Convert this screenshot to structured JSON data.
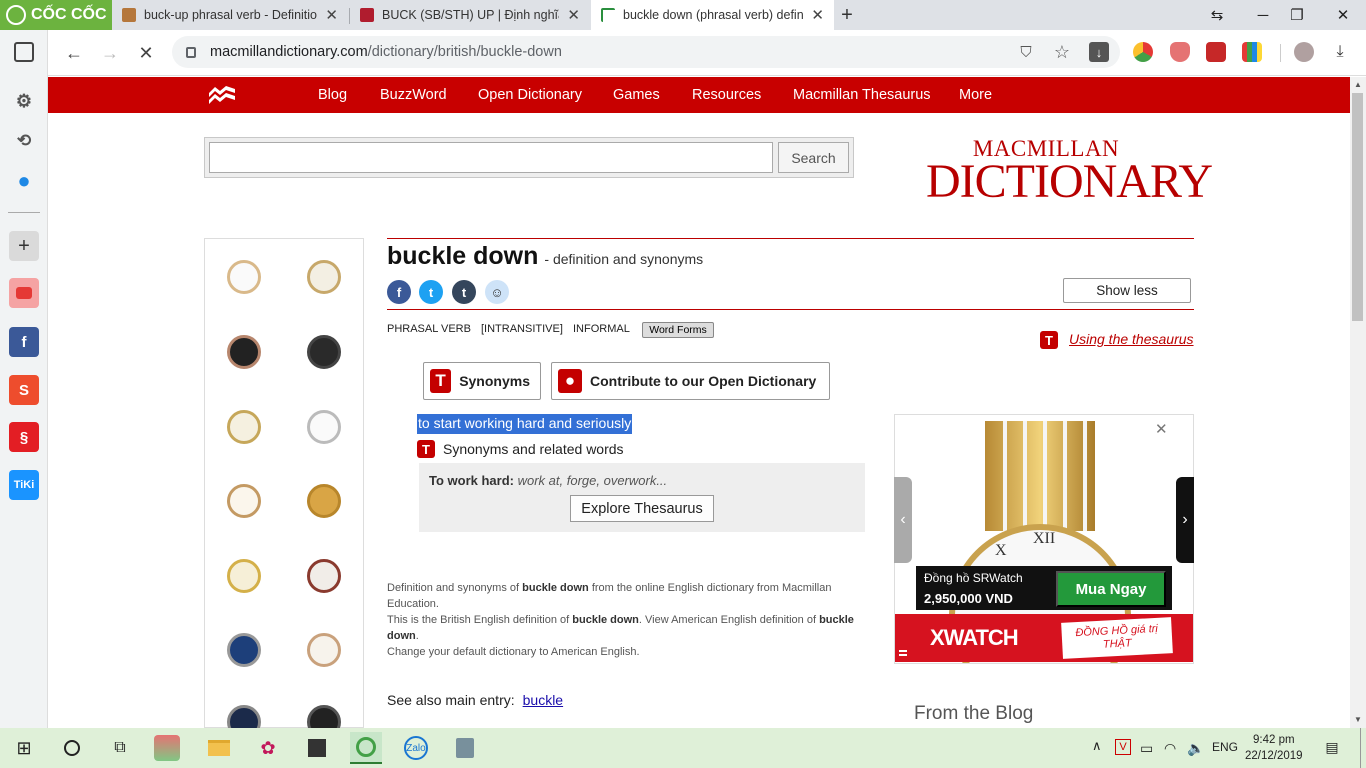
{
  "browser": {
    "brand": "CỐC CỐC",
    "tabs": [
      {
        "title": "buck-up phrasal verb - Definition, p",
        "close": "✕"
      },
      {
        "title": "BUCK (SB/STH) UP | Định nghĩa trong",
        "close": "✕"
      },
      {
        "title": "buckle down (phrasal verb) definitio",
        "close": "✕"
      }
    ],
    "new_tab": "+",
    "window_controls": {
      "minimize": "─",
      "restore": "❐",
      "close": "✕"
    },
    "url_domain": "macmillandictionary.com",
    "url_path": "/dictionary/british/buckle-down",
    "icons": [
      "back-icon",
      "forward-icon",
      "stop-icon",
      "shield-icon",
      "star-icon",
      "download-icon",
      "profile-icon"
    ]
  },
  "sidebar": {
    "items": [
      "settings-icon",
      "history-icon",
      "messenger-icon",
      "add-icon",
      "youtube-icon",
      "facebook-icon",
      "shopee-icon",
      "sendo-icon",
      "tiki-icon"
    ],
    "tiki": "TiKi",
    "shopee": "S",
    "facebook": "f",
    "add": "+"
  },
  "site_nav": [
    "Blog",
    "BuzzWord",
    "Open Dictionary",
    "Games",
    "Resources",
    "Macmillan Thesaurus",
    "More"
  ],
  "search": {
    "button": "Search",
    "value": ""
  },
  "logo": {
    "line1": "MACMILLAN",
    "line2": "DICTIONARY"
  },
  "entry": {
    "headword": "buckle down",
    "subtitle": "- definition and synonyms",
    "show_less": "Show less",
    "grammar": [
      "PHRASAL VERB",
      "[INTRANSITIVE]",
      "INFORMAL"
    ],
    "word_forms": "Word Forms",
    "using_thesaurus": "Using the thesaurus",
    "synonyms_btn": "Synonyms",
    "contribute_btn": "Contribute to our Open Dictionary",
    "definition": "to start working hard and seriously",
    "syn_related": "Synonyms and related words",
    "thesaurus_label": "To work hard:",
    "thesaurus_words": "work at, forge, overwork...",
    "explore": "Explore Thesaurus",
    "footer": {
      "l1a": "Definition and synonyms of ",
      "l1b": "buckle down",
      "l1c": " from the online English dictionary from Macmillan Education.",
      "l2a": "This is the British English definition of ",
      "l2b": "buckle down",
      "l2c": ". View American English definition of ",
      "l2d": "buckle down",
      "l2e": ".",
      "l3": "Change your default dictionary to American English."
    },
    "see_also_label": "See also main entry:",
    "see_also_link": "buckle"
  },
  "ad": {
    "close": "✕",
    "product": "Đồng hồ SRWatch",
    "price": "2,950,000 VND",
    "buy": "Mua Ngay",
    "brand": "XWATCH",
    "tagline": "ĐỒNG HỒ giá trị THẬT"
  },
  "blog_heading": "From the Blog",
  "taskbar": {
    "lang": "ENG",
    "time": "9:42 pm",
    "date": "22/12/2019",
    "apps": [
      "start-icon",
      "search-icon",
      "taskview-icon",
      "app-icon",
      "explorer-icon",
      "paint-icon",
      "sticky-icon",
      "coccoc-icon",
      "zalo-icon",
      "snip-icon"
    ],
    "zalo": "Zalo"
  },
  "colors": {
    "brand_red": "#c80000",
    "coccoc_green": "#6cb33f",
    "selection": "#3370d6"
  }
}
